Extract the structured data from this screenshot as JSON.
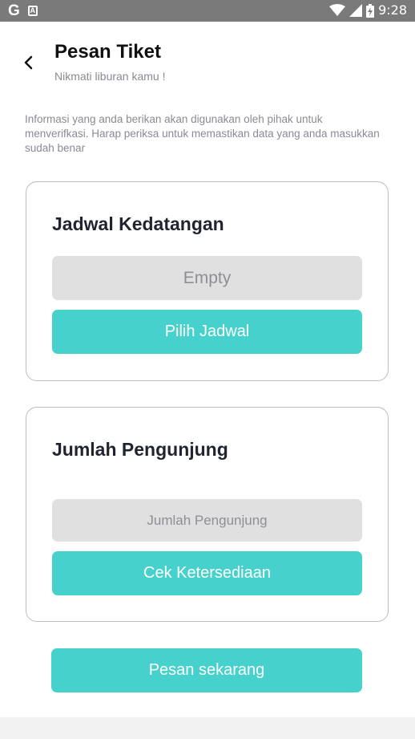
{
  "status_bar": {
    "time": "9:28",
    "left_icons": [
      "google-icon",
      "notification-a-icon"
    ],
    "right_icons": [
      "wifi-icon",
      "signal-icon",
      "battery-charging-icon"
    ]
  },
  "header": {
    "title": "Pesan Tiket",
    "subtitle": "Nikmati liburan kamu !"
  },
  "info_text": "Informasi yang anda berikan akan digunakan oleh pihak untuk menverifkasi. Harap periksa untuk memastikan data yang anda masukkan sudah benar",
  "schedule_card": {
    "title": "Jadwal Kedatangan",
    "value": "Empty",
    "button_label": "Pilih Jadwal"
  },
  "visitor_card": {
    "title": "Jumlah Pengunjung",
    "placeholder": "Jumlah Pengunjung",
    "button_label": "Cek Ketersediaan"
  },
  "submit_label": "Pesan sekarang",
  "colors": {
    "accent": "#47d1cc",
    "status_bar": "#7a7a7a",
    "field_bg": "#e0e0e0"
  }
}
